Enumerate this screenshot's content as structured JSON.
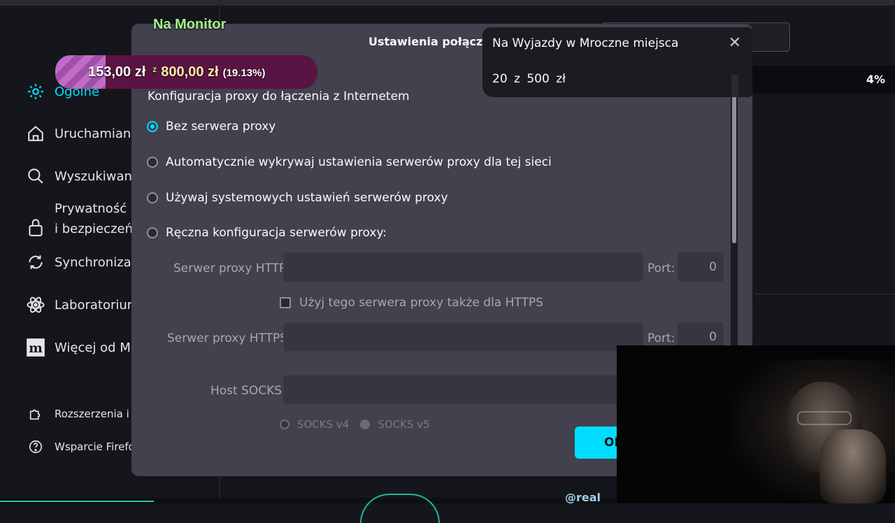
{
  "sidebar": {
    "items": [
      {
        "label": "Ogólne",
        "icon": "gear-icon"
      },
      {
        "label": "Uruchamianie",
        "icon": "home-icon"
      },
      {
        "label": "Wyszukiwanie",
        "icon": "search-icon"
      },
      {
        "label_line1": "Prywatność",
        "label_line2": "i bezpieczeńs",
        "icon": "lock-icon"
      },
      {
        "label": "Synchronizacj",
        "icon": "sync-icon"
      },
      {
        "label": "Laboratorium",
        "icon": "atom-icon"
      },
      {
        "label": "Więcej od Mo",
        "icon": "mozilla-icon"
      }
    ],
    "footer": [
      {
        "label": "Rozszerzenia i m",
        "icon": "puzzle-icon"
      },
      {
        "label": "Wsparcie Firefo",
        "icon": "help-icon"
      }
    ]
  },
  "background": {
    "percent": "4%",
    "handle": "@real"
  },
  "dialog": {
    "title": "Ustawienia połączen",
    "heading": "Konfiguracja proxy do łączenia z Internetem",
    "options": [
      {
        "label": "Bez serwera proxy",
        "selected": true
      },
      {
        "label": "Automatycznie wykrywaj ustawienia serwerów proxy dla tej sieci",
        "selected": false
      },
      {
        "label": "Używaj systemowych ustawień serwerów proxy",
        "selected": false
      },
      {
        "label": "Ręczna konfiguracja serwerów proxy:",
        "selected": false
      }
    ],
    "http_label": "Serwer proxy HTTP:",
    "http_value": "",
    "http_port_label": "Port:",
    "http_port": "0",
    "also_https_label": "Użyj tego serwera proxy także dla HTTPS",
    "https_label": "Serwer proxy HTTPS:",
    "https_value": "",
    "https_port_label": "Port:",
    "https_port": "0",
    "socks_label": "Host SOCKS:",
    "socks_value": "",
    "socks4_label": "SOCKS v4",
    "socks5_label": "SOCKS v5",
    "ok_label": "OK"
  },
  "overlay": {
    "goal_title": "Na Monitor",
    "goal_current": "153,00 zł",
    "goal_of": "z",
    "goal_total": "800,00 zł",
    "goal_percent": "(19.13%)",
    "goal_progress": 0.1913,
    "popup_title": "Na Wyjazdy w Mroczne miejsca",
    "popup_amount": "20 z 500 zł"
  },
  "colors": {
    "accent": "#00ddff",
    "dialog_bg": "#42414d",
    "goal_bar": "#5a1444",
    "goal_title": "#a8f08c"
  }
}
